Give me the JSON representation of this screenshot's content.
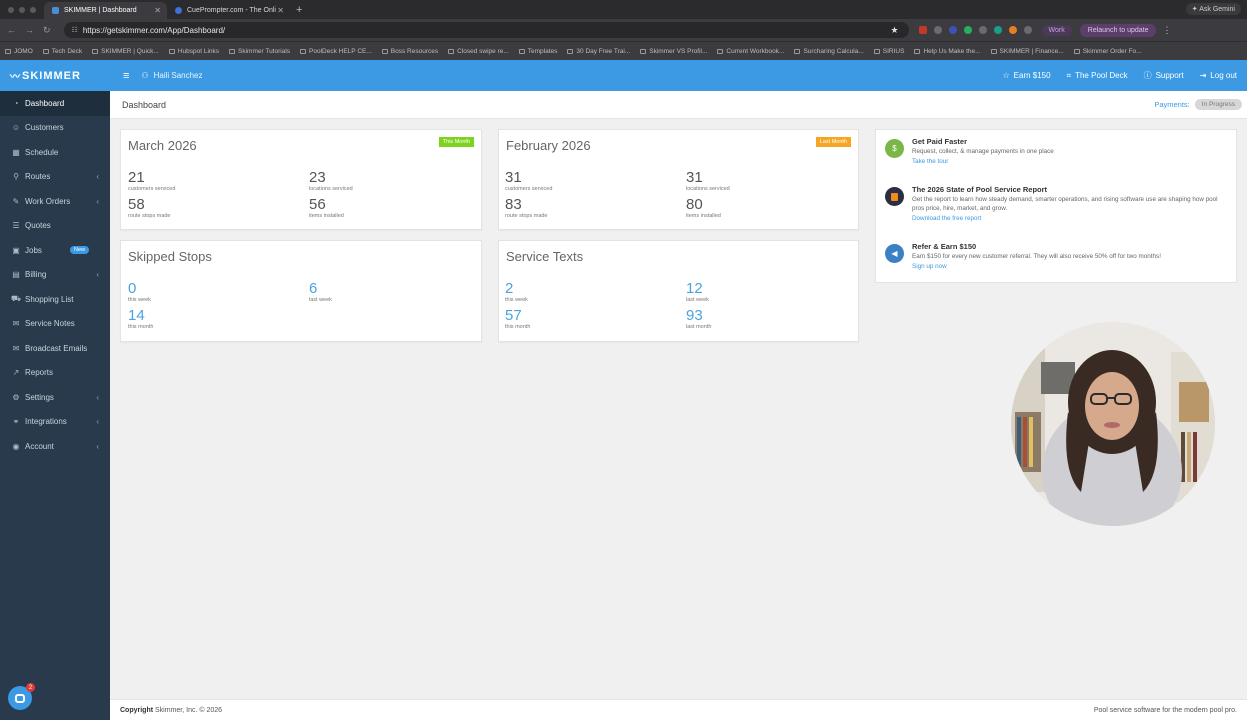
{
  "browser": {
    "tabs": [
      {
        "label": "SKIMMER | Dashboard",
        "active": true
      },
      {
        "label": "CuePrompter.com - The Onli",
        "active": false
      }
    ],
    "ask_label": "Ask Gemini",
    "url": "https://getskimmer.com/App/Dashboard/",
    "profile_label": "Work",
    "relaunch_label": "Relaunch to update",
    "ext_count": "143",
    "bookmarks": [
      "JOMO",
      "Tech Deck",
      "SKIMMER | Quick...",
      "Hubspot Links",
      "Skimmer Tutorials",
      "PoolDeck HELP CE...",
      "Boss Resources",
      "Closed swipe re...",
      "Templates",
      "30 Day Free Trai...",
      "Skimmer VS Profil...",
      "Current Workbook...",
      "Surcharing Calcula...",
      "SIRIUS",
      "Help Us Make the...",
      "SKIMMER | Finance...",
      "Skimmer Order Fo..."
    ]
  },
  "sidebar": {
    "brand": "SKIMMER",
    "items": [
      {
        "label": "Dashboard",
        "icon": "dashboard-icon",
        "active": true
      },
      {
        "label": "Customers",
        "icon": "customers-icon"
      },
      {
        "label": "Schedule",
        "icon": "calendar-icon"
      },
      {
        "label": "Routes",
        "icon": "routes-icon",
        "chevron": true
      },
      {
        "label": "Work Orders",
        "icon": "work-orders-icon",
        "chevron": true
      },
      {
        "label": "Quotes",
        "icon": "quotes-icon"
      },
      {
        "label": "Jobs",
        "icon": "jobs-icon",
        "badge": "New"
      },
      {
        "label": "Billing",
        "icon": "billing-icon",
        "chevron": true
      },
      {
        "label": "Shopping List",
        "icon": "cart-icon"
      },
      {
        "label": "Service Notes",
        "icon": "notes-icon"
      },
      {
        "label": "Broadcast Emails",
        "icon": "email-icon"
      },
      {
        "label": "Reports",
        "icon": "reports-icon"
      },
      {
        "label": "Settings",
        "icon": "gear-icon",
        "chevron": true
      },
      {
        "label": "Integrations",
        "icon": "integrations-icon",
        "chevron": true
      },
      {
        "label": "Account",
        "icon": "account-icon",
        "chevron": true
      }
    ]
  },
  "topbar": {
    "user_name": "Haili Sanchez",
    "earn": "Earn $150",
    "pool_deck": "The Pool Deck",
    "support": "Support",
    "logout": "Log out"
  },
  "subheader": {
    "title": "Dashboard",
    "payments_label": "Payments:",
    "payments_status": "In Progress"
  },
  "cards": {
    "march": {
      "title": "March 2026",
      "tag": "This Month",
      "tag_color": "#7ed321",
      "stats": [
        {
          "num": "21",
          "label": "customers serviced"
        },
        {
          "num": "23",
          "label": "locations serviced"
        },
        {
          "num": "58",
          "label": "route stops made"
        },
        {
          "num": "56",
          "label": "items installed"
        }
      ]
    },
    "february": {
      "title": "February 2026",
      "tag": "Last Month",
      "tag_color": "#f5a623",
      "stats": [
        {
          "num": "31",
          "label": "customers serviced"
        },
        {
          "num": "31",
          "label": "locations serviced"
        },
        {
          "num": "83",
          "label": "route stops made"
        },
        {
          "num": "80",
          "label": "items installed"
        }
      ]
    },
    "skipped": {
      "title": "Skipped Stops",
      "stats": [
        {
          "num": "0",
          "label": "this week"
        },
        {
          "num": "6",
          "label": "last week"
        },
        {
          "num": "14",
          "label": "this month"
        }
      ]
    },
    "texts": {
      "title": "Service Texts",
      "stats": [
        {
          "num": "2",
          "label": "this week"
        },
        {
          "num": "12",
          "label": "last week"
        },
        {
          "num": "57",
          "label": "this month"
        },
        {
          "num": "93",
          "label": "last month"
        }
      ]
    }
  },
  "promos": [
    {
      "title": "Get Paid Faster",
      "desc": "Request, collect, & manage payments in one place",
      "link": "Take the tour",
      "color": "#7ab648",
      "icon": "dollar-icon"
    },
    {
      "title": "The 2026 State of Pool Service Report",
      "desc": "Get the report to learn how steady demand, smarter operations, and rising software use are shaping how pool pros price, hire, market, and grow.",
      "link": "Download the free report",
      "color": "#2b2d42",
      "icon": "report-icon"
    },
    {
      "title": "Refer & Earn $150",
      "desc": "Earn $150 for every new customer referral. They will also receive 50% off for two months!",
      "link": "Sign up now",
      "color": "#3b7fc4",
      "icon": "megaphone-icon"
    }
  ],
  "footer": {
    "copyright_bold": "Copyright",
    "copyright_rest": " Skimmer, Inc. © 2026",
    "tagline": "Pool service software for the modern pool pro."
  },
  "chat": {
    "badge": "2"
  }
}
